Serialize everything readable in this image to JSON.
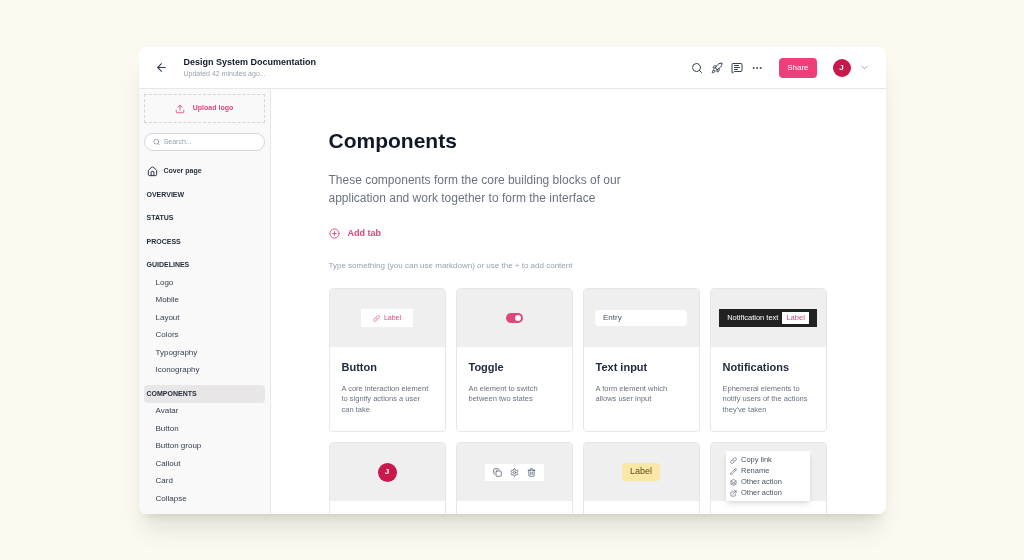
{
  "header": {
    "title": "Design System Documentation",
    "subtitle": "Updated 42 minutes ago...",
    "share": "Share",
    "avatar": "J"
  },
  "sidebar": {
    "upload": "Upload logo",
    "search": {
      "placeholder": "Search..."
    },
    "items": [
      {
        "kind": "page",
        "label": "Cover page",
        "selected": false
      },
      {
        "kind": "section",
        "label": "OVERVIEW",
        "selected": false
      },
      {
        "kind": "section",
        "label": "STATUS",
        "selected": false
      },
      {
        "kind": "section",
        "label": "PROCESS",
        "selected": false
      },
      {
        "kind": "section",
        "label": "GUIDELINES",
        "selected": false,
        "children": [
          {
            "label": "Logo",
            "selected": false
          },
          {
            "label": "Mobile",
            "selected": false
          },
          {
            "label": "Layout",
            "selected": false
          },
          {
            "label": "Colors",
            "selected": false
          },
          {
            "label": "Typography",
            "selected": false
          },
          {
            "label": "Iconography",
            "selected": false
          }
        ]
      },
      {
        "kind": "section",
        "label": "COMPONENTS",
        "selected": true,
        "children": [
          {
            "label": "Avatar",
            "selected": false
          },
          {
            "label": "Button",
            "selected": false
          },
          {
            "label": "Button group",
            "selected": false
          },
          {
            "label": "Callout",
            "selected": false
          },
          {
            "label": "Card",
            "selected": false
          },
          {
            "label": "Collapse",
            "selected": false
          }
        ]
      }
    ]
  },
  "main": {
    "title": "Components",
    "description": "These components form the core building blocks of our application and work together to form the interface",
    "add_tab": "Add tab",
    "placeholder": "Type something (you can use markdown) or use the + to add content",
    "cards": [
      {
        "kind": "button",
        "preview": "Label",
        "title": "Button",
        "description": "A core interaction element to signify actions a user can take"
      },
      {
        "kind": "toggle",
        "on": true,
        "title": "Toggle",
        "description": "An element to switch between two states"
      },
      {
        "kind": "input",
        "preview": "Entry",
        "title": "Text input",
        "description": "A form element which allows user input"
      },
      {
        "kind": "notification",
        "preview": "Notification text",
        "action": "Label",
        "title": "Notifications",
        "description": "Ephemeral elements to notify users of the actions they've taken"
      },
      {
        "kind": "avatar",
        "preview": "J"
      },
      {
        "kind": "icons"
      },
      {
        "kind": "label",
        "preview": "Label"
      },
      {
        "kind": "menu",
        "items": [
          "Copy link",
          "Rename",
          "Other action",
          "Other action"
        ]
      }
    ]
  }
}
